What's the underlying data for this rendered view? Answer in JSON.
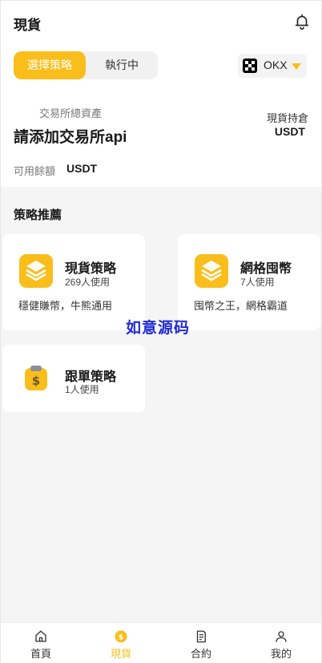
{
  "header": {
    "title": "現貨"
  },
  "segment": {
    "selected": "選擇策略",
    "other": "執行中"
  },
  "exchange": {
    "name": "OKX"
  },
  "assets": {
    "total_label": "交易所總資產",
    "add_api": "請添加交易所api",
    "spot_label": "現貨持倉",
    "spot_unit": "USDT",
    "available_label": "可用餘額",
    "available_unit": "USDT"
  },
  "section": {
    "title": "策略推薦"
  },
  "strategies": [
    {
      "name": "現貨策略",
      "users": "269人使用",
      "desc": "穩健賺幣，牛熊通用"
    },
    {
      "name": "網格囤幣",
      "users": "7人使用",
      "desc": "囤幣之王，網格霸道"
    },
    {
      "name": "跟單策略",
      "users": "1人使用",
      "desc": ""
    }
  ],
  "watermark": "如意源码",
  "tabbar": {
    "items": [
      {
        "label": "首頁"
      },
      {
        "label": "現貨"
      },
      {
        "label": "合約"
      },
      {
        "label": "我的"
      }
    ]
  },
  "colors": {
    "accent": "#f9be1b",
    "background": "#f5f5f6",
    "watermark": "#1f2bd8"
  }
}
